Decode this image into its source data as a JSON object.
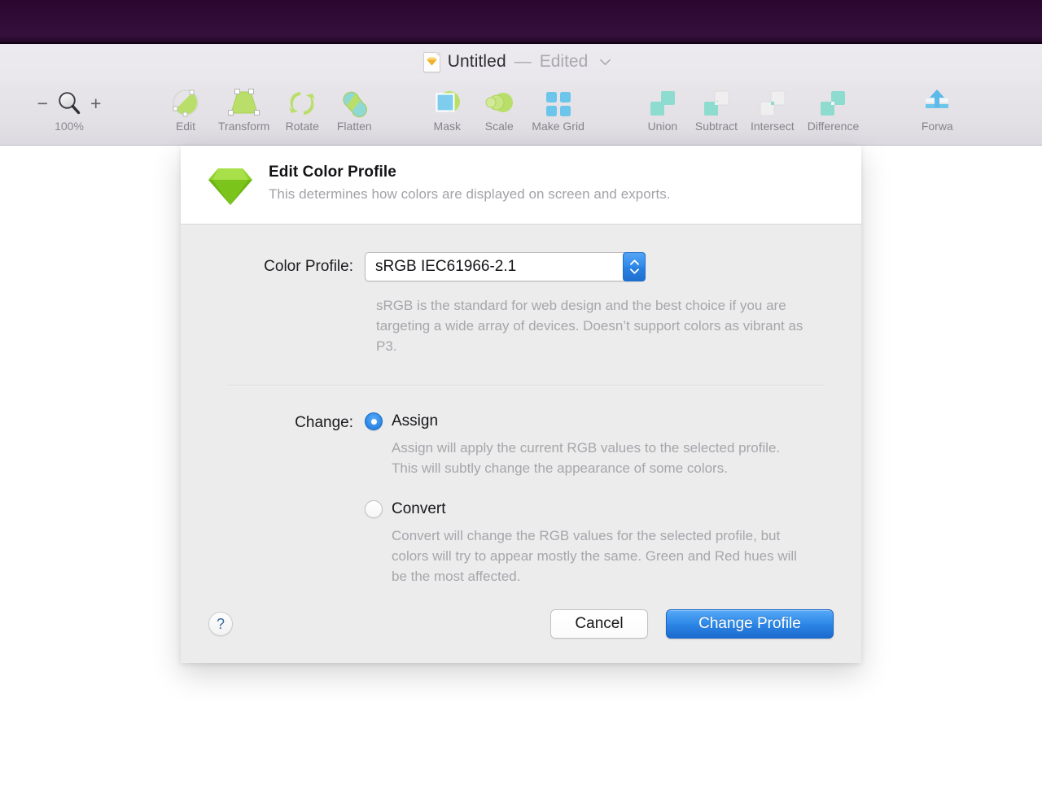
{
  "window": {
    "title": "Untitled",
    "dash": "—",
    "edited_label": "Edited"
  },
  "toolbar": {
    "zoom": {
      "minus": "−",
      "plus": "+",
      "level": "100%"
    },
    "items": [
      {
        "label": "Edit",
        "icon": "edit-vector-icon"
      },
      {
        "label": "Transform",
        "icon": "transform-icon"
      },
      {
        "label": "Rotate",
        "icon": "rotate-icon"
      },
      {
        "label": "Flatten",
        "icon": "flatten-icon"
      },
      {
        "label": "Mask",
        "icon": "mask-icon"
      },
      {
        "label": "Scale",
        "icon": "scale-icon"
      },
      {
        "label": "Make Grid",
        "icon": "make-grid-icon"
      },
      {
        "label": "Union",
        "icon": "union-icon"
      },
      {
        "label": "Subtract",
        "icon": "subtract-icon"
      },
      {
        "label": "Intersect",
        "icon": "intersect-icon"
      },
      {
        "label": "Difference",
        "icon": "difference-icon"
      },
      {
        "label": "Forwa",
        "icon": "forward-icon"
      }
    ]
  },
  "dialog": {
    "title": "Edit Color Profile",
    "subtitle": "This determines how colors are displayed on screen and exports.",
    "profile": {
      "label": "Color Profile:",
      "value": "sRGB IEC61966-2.1",
      "description": "sRGB is the standard for web design and the best choice if you are targeting a wide array of devices. Doesn’t support colors as vibrant as P3."
    },
    "change": {
      "label": "Change:",
      "options": [
        {
          "name": "Assign",
          "selected": true,
          "description": "Assign will apply the current RGB values to the selected profile. This will subtly change the appearance of some colors."
        },
        {
          "name": "Convert",
          "selected": false,
          "description": "Convert will change the RGB values for the selected profile, but colors will try to appear mostly the same. Green and Red hues will be the most affected."
        }
      ]
    },
    "footer": {
      "help": "?",
      "cancel": "Cancel",
      "confirm": "Change Profile"
    }
  },
  "colors": {
    "accent_blue": "#2f8ae8",
    "desktop_purple": "#300b36",
    "sketch_green": "#8fd32e",
    "dialog_bg": "#ececec"
  }
}
